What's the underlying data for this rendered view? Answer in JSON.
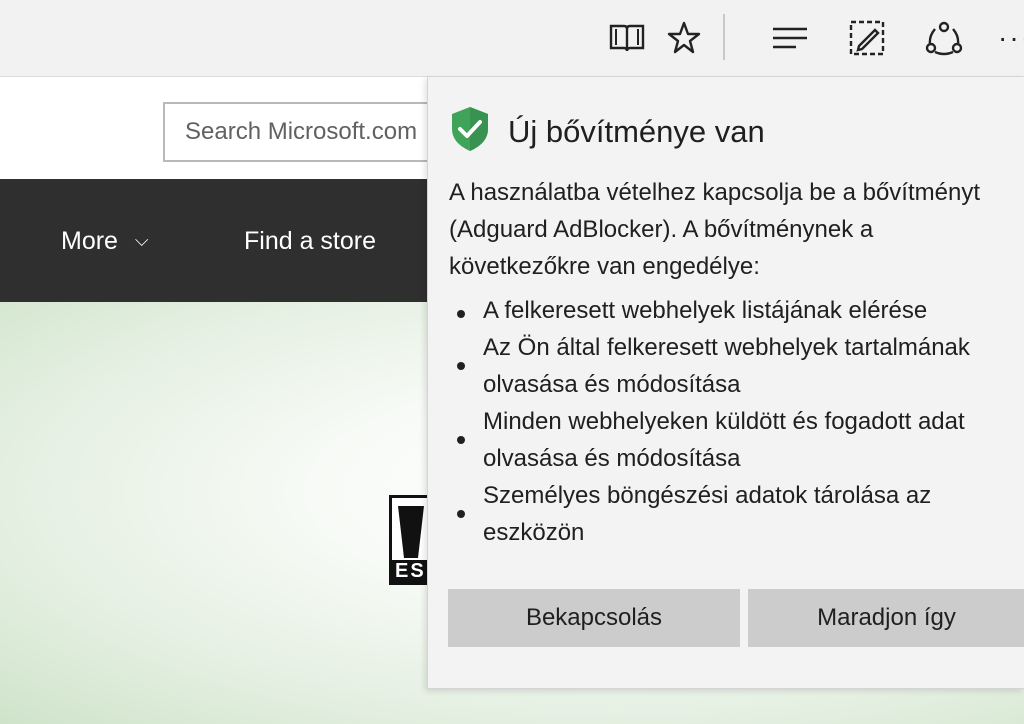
{
  "toolbar": {
    "icons": [
      "reading-view-icon",
      "favorite-star-icon",
      "hub-icon",
      "web-note-icon",
      "share-icon",
      "more-icon"
    ],
    "more_label": "···"
  },
  "page": {
    "search": {
      "placeholder": "Search Microsoft.com"
    },
    "nav": {
      "more_label": "More",
      "more_chevron": "⌵",
      "find_store_label": "Find a store"
    },
    "esrb_letters": "ES"
  },
  "popup": {
    "title": "Új bővítménye van",
    "description_lines": [
      "A használatba vételhez kapcsolja be a bővítményt",
      "(Adguard AdBlocker). A bővítménynek a",
      "következőkre van engedélye:"
    ],
    "permissions": [
      [
        "A felkeresett webhelyek listájának elérése"
      ],
      [
        "Az Ön által felkeresett webhelyek tartalmának",
        "olvasása és módosítása"
      ],
      [
        "Minden webhelyeken küldött és fogadott adat",
        "olvasása és módosítása"
      ],
      [
        "Személyes böngészési adatok tárolása az",
        "eszközön"
      ]
    ],
    "buttons": {
      "enable": "Bekapcsolás",
      "keep": "Maradjon így"
    },
    "shield_color": "#3fa35a"
  }
}
